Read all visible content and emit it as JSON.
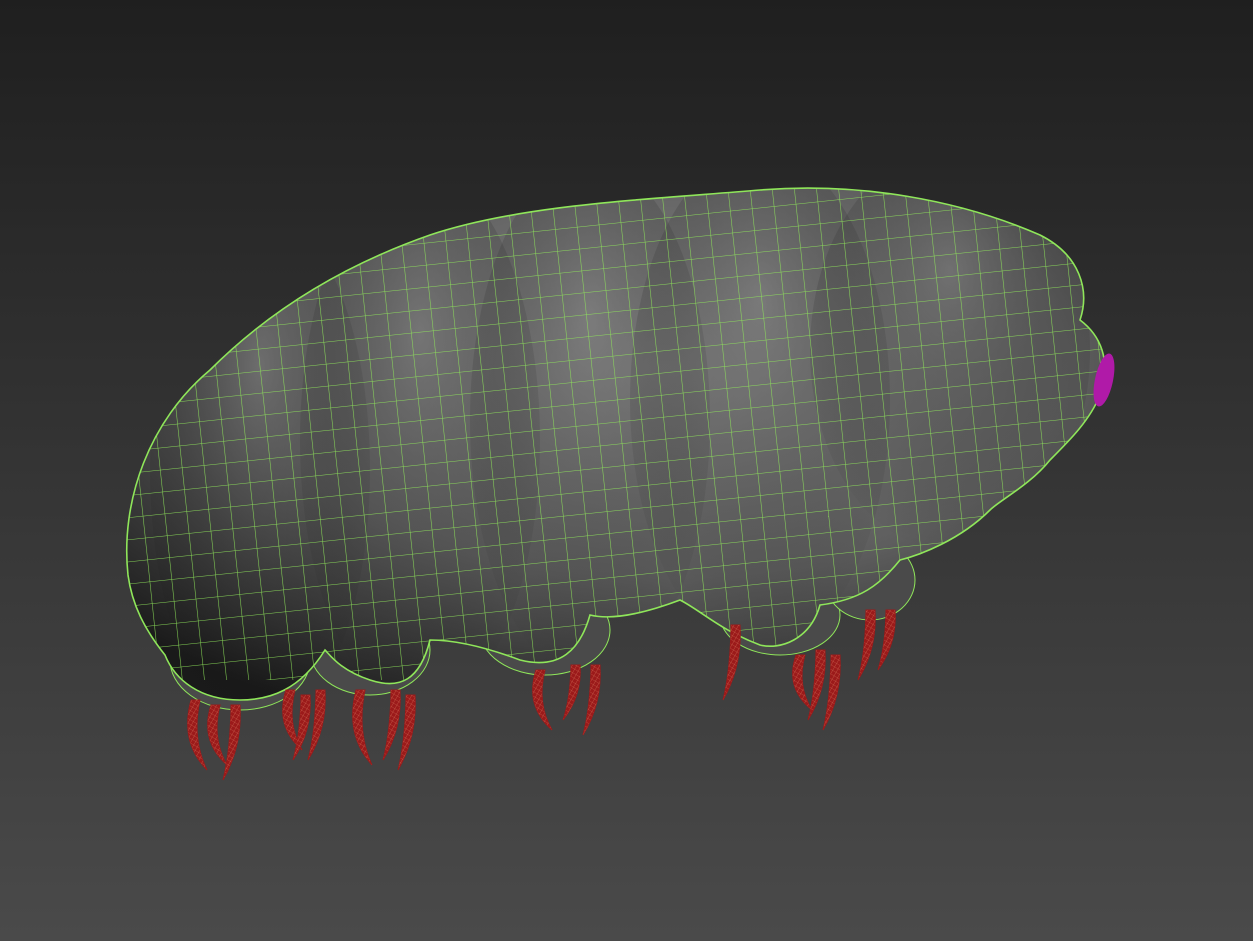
{
  "viewport": {
    "background_top": "#1f1f1f",
    "background_bottom": "#4a4a4a",
    "model_name": "tardigrade-mesh",
    "body_color": "#6a6a6a",
    "wireframe_color": "#8fe65a",
    "claw_color": "#9b1a1a",
    "claw_wire_color": "#d06a55",
    "mouth_color": "#b01aa8"
  }
}
